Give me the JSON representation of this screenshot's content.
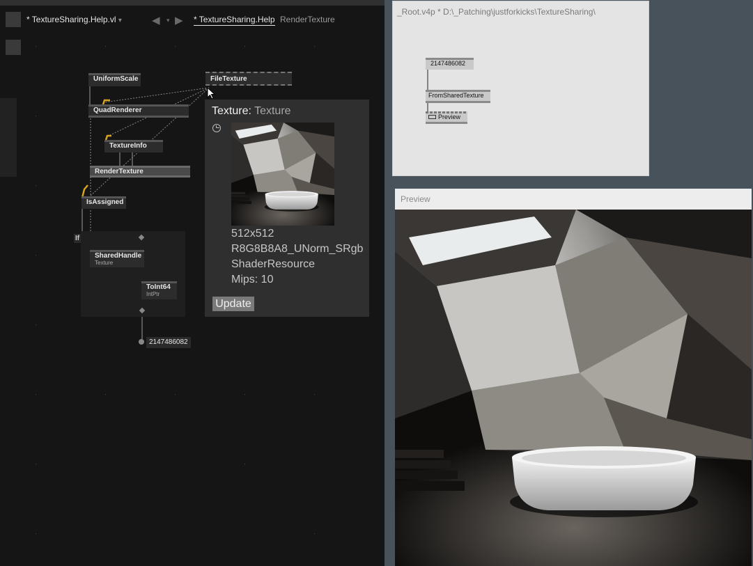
{
  "vl_editor": {
    "document_tab": "* TextureSharing.Help.vl",
    "document_tab_dropdown": "▾",
    "nav_back": "◀",
    "nav_menu": "▾",
    "nav_forward": "▶",
    "patch_tabs": [
      {
        "label": "* TextureSharing.Help",
        "active": true
      },
      {
        "label": "RenderTexture",
        "active": false
      }
    ],
    "nodes": {
      "uniformscale": "UniformScale",
      "filetexture": "FileTexture",
      "quadrenderer": "QuadRenderer",
      "textureinfo": "TextureInfo",
      "rendertexture": "RenderTexture",
      "isassigned": "IsAssigned",
      "if_region": "If",
      "sharedhandle": "SharedHandle",
      "sharedhandle_sub": "Texture",
      "toint64": "ToInt64",
      "toint64_sub": "IntPtr"
    },
    "output_value": "2147486082",
    "tooltip": {
      "pin_name": "Texture",
      "separator": ":",
      "pin_type": "Texture",
      "lines": [
        "512x512",
        "R8G8B8A8_UNorm_SRgb",
        "ShaderResource",
        "Mips: 10"
      ],
      "update_label": "Update"
    }
  },
  "root_patch": {
    "title": "_Root.v4p *  D:\\_Patching\\justforkicks\\TextureSharing\\",
    "iobox_value": "2147486082",
    "node_fromshared": "FromSharedTexture",
    "node_preview": "Preview"
  },
  "preview": {
    "title": "Preview"
  },
  "colors": {
    "editor_bg": "#151515",
    "desktop_bg": "#48525a",
    "link_highlight": "#d9a320",
    "node_bg": "#2c2c2c"
  }
}
